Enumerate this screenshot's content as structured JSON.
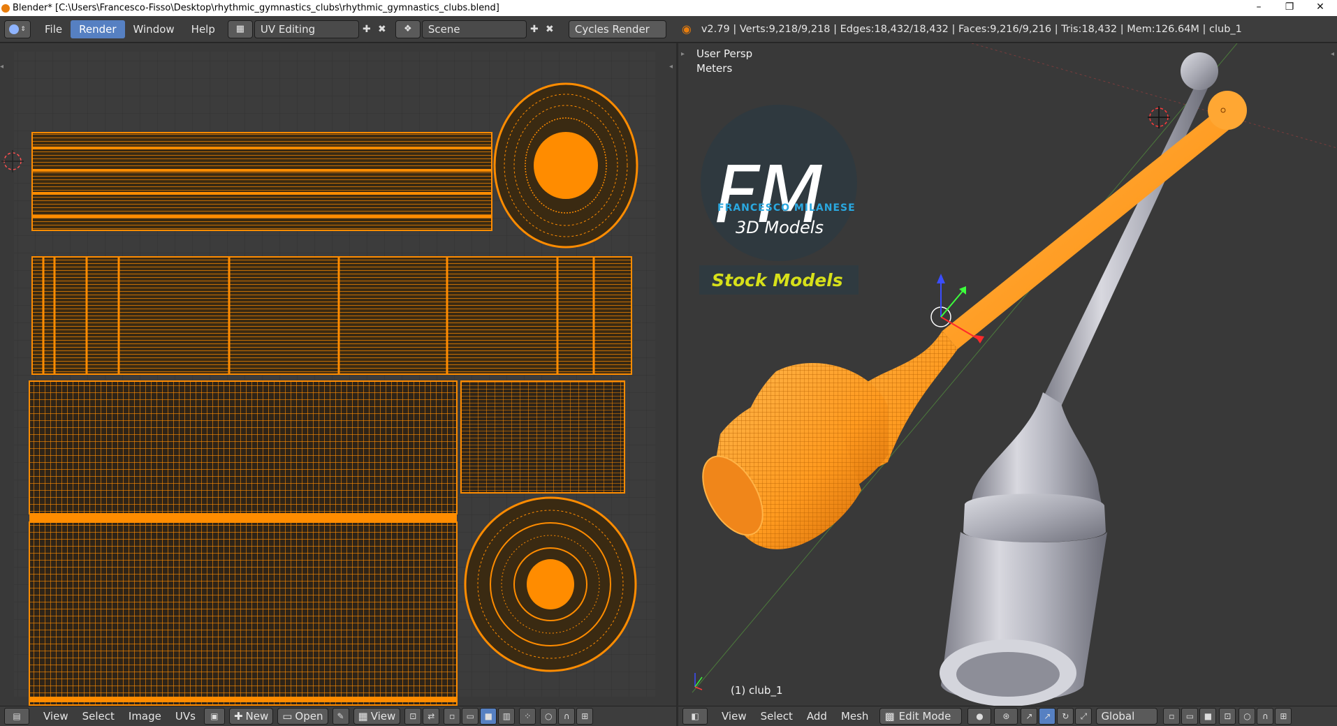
{
  "window": {
    "title": "Blender* [C:\\Users\\Francesco-Fisso\\Desktop\\rhythmic_gymnastics_clubs\\rhythmic_gymnastics_clubs.blend]",
    "min_glyph": "–",
    "max_glyph": "❐",
    "close_glyph": "✕"
  },
  "menu": {
    "file": "File",
    "render": "Render",
    "window": "Window",
    "help": "Help"
  },
  "layout": {
    "name": "UV Editing"
  },
  "scene": {
    "name": "Scene"
  },
  "engine": {
    "name": "Cycles Render"
  },
  "stats": "v2.79 | Verts:9,218/9,218 | Edges:18,432/18,432 | Faces:9,216/9,216 | Tris:18,432 | Mem:126.64M | club_1",
  "viewport": {
    "view_name": "User Persp",
    "units": "Meters",
    "object_label": "(1) club_1",
    "watermark": {
      "initials": "FM",
      "brand": "FRANCESCO MILANESE",
      "subtitle": "3D Models",
      "banner": "Stock Models"
    }
  },
  "uv_footer": {
    "view": "View",
    "select": "Select",
    "image": "Image",
    "uvs": "UVs",
    "new": "New",
    "open": "Open",
    "view2": "View"
  },
  "vp_footer": {
    "view": "View",
    "select": "Select",
    "add": "Add",
    "mesh": "Mesh",
    "mode": "Edit Mode",
    "orientation": "Global"
  },
  "colors": {
    "accent": "#5680c2",
    "uv_orange": "#ff8c00",
    "header_bg": "#3d3d3d",
    "panel_bg": "#393939"
  }
}
